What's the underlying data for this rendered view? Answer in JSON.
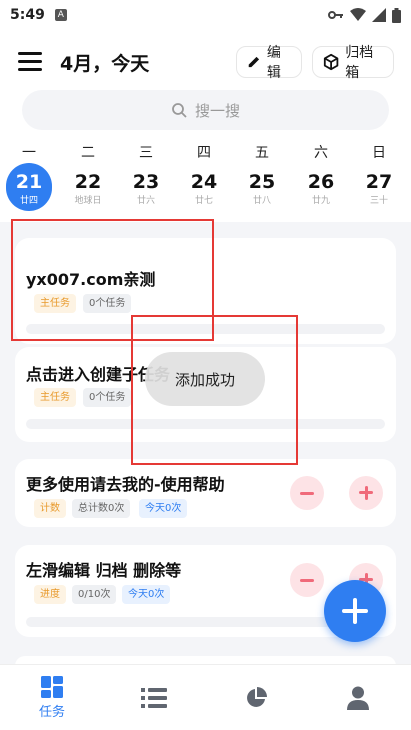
{
  "statusbar": {
    "time": "5:49",
    "app_badge": "A"
  },
  "header": {
    "title": "4月，今天",
    "edit_label": "编辑",
    "archive_label": "归档箱"
  },
  "search": {
    "placeholder": "搜一搜"
  },
  "calendar": {
    "weekdays": [
      "一",
      "二",
      "三",
      "四",
      "五",
      "六",
      "日"
    ],
    "dates": [
      {
        "num": "21",
        "lunar": "廿四",
        "active": true
      },
      {
        "num": "22",
        "lunar": "地球日"
      },
      {
        "num": "23",
        "lunar": "廿六"
      },
      {
        "num": "24",
        "lunar": "廿七"
      },
      {
        "num": "25",
        "lunar": "廿八"
      },
      {
        "num": "26",
        "lunar": "廿九"
      },
      {
        "num": "27",
        "lunar": "三十"
      }
    ]
  },
  "tasks": [
    {
      "title": "yx007.com亲测",
      "tags": [
        "主任务",
        "0个任务"
      ]
    },
    {
      "title": "点击进入创建子任务",
      "tags": [
        "主任务",
        "0个任务"
      ]
    },
    {
      "title": "更多使用请去我的-使用帮助",
      "tags": [
        "计数",
        "总计数0次",
        "今天0次"
      ]
    },
    {
      "title": "左滑编辑 归档 删除等",
      "tags": [
        "进度",
        "0/10次",
        "今天0次"
      ]
    }
  ],
  "toast": "添加成功",
  "bottom_nav": {
    "tasks_label": "任务"
  },
  "colors": {
    "accent": "#2f7ef1",
    "annotation": "#e53935",
    "stepper": "#f06a7a"
  }
}
